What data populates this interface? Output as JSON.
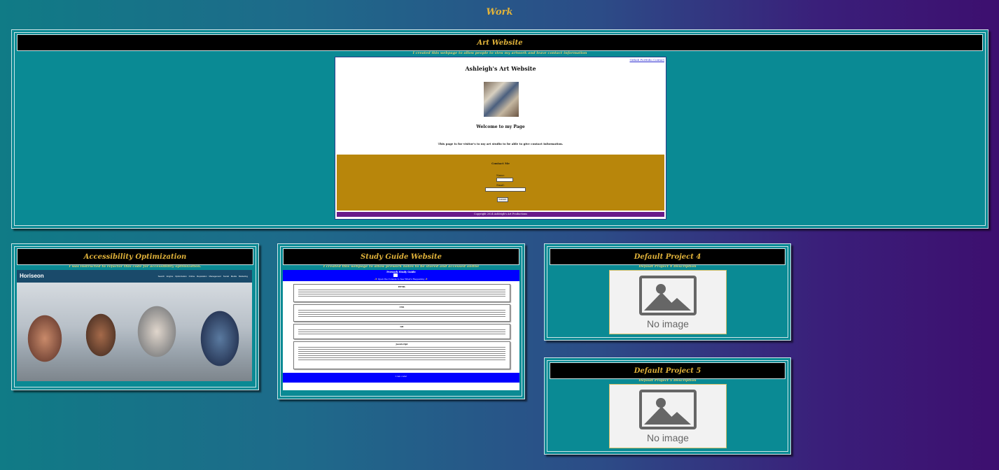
{
  "page": {
    "title": "Work"
  },
  "colors": {
    "accent": "#e0b23a",
    "card": "#0a8a94",
    "header": "#000000"
  },
  "projects": [
    {
      "title": "Art Website",
      "description": "I created this webpage to allow people to view my artwork and leave contact information",
      "preview": {
        "nav": "Github Portfolio Contact",
        "heading": "Ashleigh's Art Website",
        "welcome": "Welcome to my Page",
        "info": "This page is for visitor's to my art studio to be able to give contact information.",
        "contact_title": "Contact Me",
        "name_label": "Name:",
        "email_label": "Email:",
        "submit": "Submit",
        "footer": "Copyright 2024 Ashleigh's Art Productions"
      }
    },
    {
      "title": "Accessibility Optimization",
      "description": "I was instructed to refactor this code for accessibility optimization.",
      "preview": {
        "logo": "Horiseon",
        "nav": "Search Engine Optimization  Online Reputation Management  Social Media Marketing"
      }
    },
    {
      "title": "Study Guide Website",
      "description": "I created this webpage to allow prework notes to be stored and accessed online",
      "preview": {
        "title": "Prework Study Guide",
        "subtitle": "✨ Open the Console to See What's Happening ✨",
        "sections": [
          "HTML",
          "CSS",
          "Git",
          "JavaScript"
        ],
        "footer": "I can code!"
      }
    },
    {
      "title": "Default Project 4",
      "description": "Default Project 4 Description",
      "image_label": "No image"
    },
    {
      "title": "Default Project 5",
      "description": "Default Project 5 Description",
      "image_label": "No image"
    }
  ]
}
